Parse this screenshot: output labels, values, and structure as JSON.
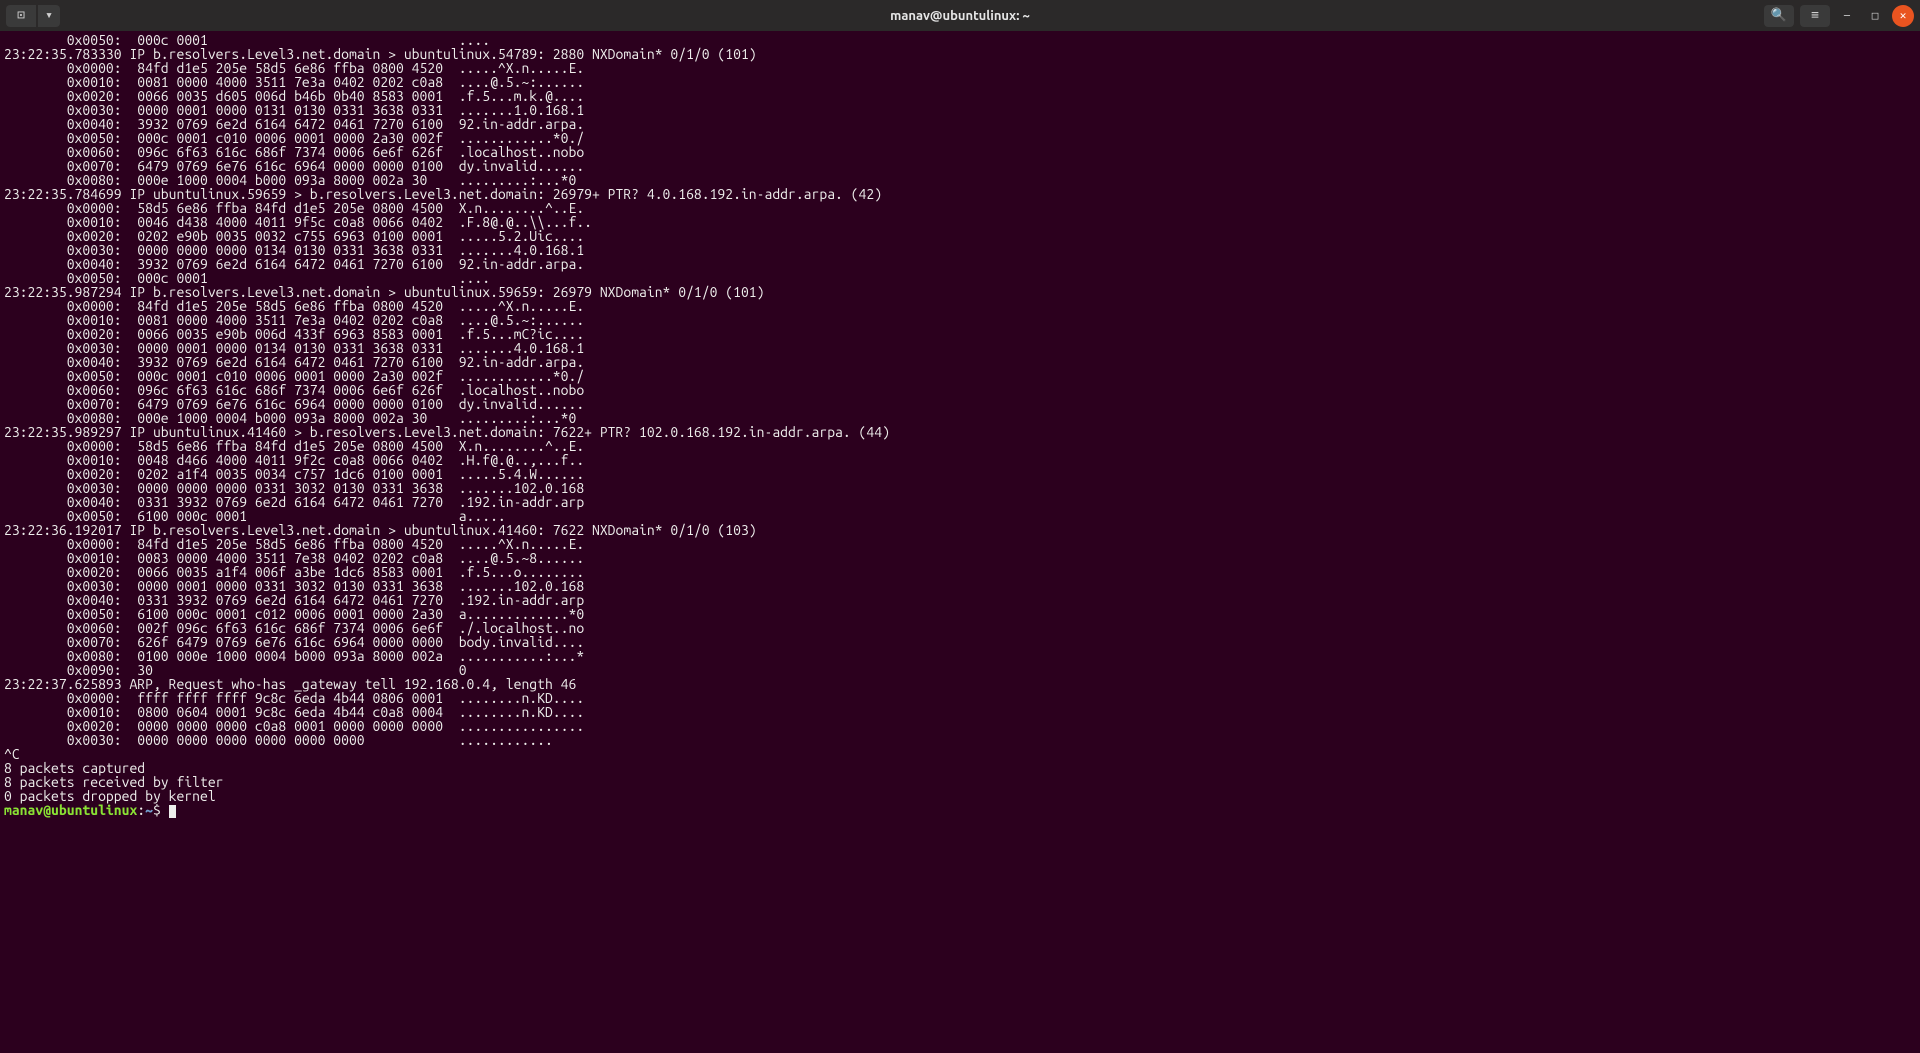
{
  "window": {
    "title": "manav@ubuntulinux: ~"
  },
  "prompt": {
    "user": "manav",
    "host": "ubuntulinux",
    "path": "~",
    "sep1": "@",
    "sep2": ":",
    "sigil": "$ "
  },
  "icons": {
    "new_tab": "⊡",
    "dropdown": "▾",
    "search": "🔍",
    "menu": "≡",
    "minimize": "—",
    "maximize": "□",
    "close": "✕"
  },
  "lines": [
    "        0x0050:  000c 0001                                ....",
    "23:22:35.783330 IP b.resolvers.Level3.net.domain > ubuntulinux.54789: 2880 NXDomain* 0/1/0 (101)",
    "        0x0000:  84fd d1e5 205e 58d5 6e86 ffba 0800 4520  .....^X.n.....E.",
    "        0x0010:  0081 0000 4000 3511 7e3a 0402 0202 c0a8  ....@.5.~:......",
    "        0x0020:  0066 0035 d605 006d b46b 0b40 8583 0001  .f.5...m.k.@....",
    "        0x0030:  0000 0001 0000 0131 0130 0331 3638 0331  .......1.0.168.1",
    "        0x0040:  3932 0769 6e2d 6164 6472 0461 7270 6100  92.in-addr.arpa.",
    "        0x0050:  000c 0001 c010 0006 0001 0000 2a30 002f  ............*0./",
    "        0x0060:  096c 6f63 616c 686f 7374 0006 6e6f 626f  .localhost..nobo",
    "        0x0070:  6479 0769 6e76 616c 6964 0000 0000 0100  dy.invalid......",
    "        0x0080:  000e 1000 0004 b000 093a 8000 002a 30    .........:...*0",
    "23:22:35.784699 IP ubuntulinux.59659 > b.resolvers.Level3.net.domain: 26979+ PTR? 4.0.168.192.in-addr.arpa. (42)",
    "        0x0000:  58d5 6e86 ffba 84fd d1e5 205e 0800 4500  X.n........^..E.",
    "        0x0010:  0046 d438 4000 4011 9f5c c0a8 0066 0402  .F.8@.@..\\\\...f..",
    "        0x0020:  0202 e90b 0035 0032 c755 6963 0100 0001  .....5.2.Uic....",
    "        0x0030:  0000 0000 0000 0134 0130 0331 3638 0331  .......4.0.168.1",
    "        0x0040:  3932 0769 6e2d 6164 6472 0461 7270 6100  92.in-addr.arpa.",
    "        0x0050:  000c 0001                                ....",
    "23:22:35.987294 IP b.resolvers.Level3.net.domain > ubuntulinux.59659: 26979 NXDomain* 0/1/0 (101)",
    "        0x0000:  84fd d1e5 205e 58d5 6e86 ffba 0800 4520  .....^X.n.....E.",
    "        0x0010:  0081 0000 4000 3511 7e3a 0402 0202 c0a8  ....@.5.~:......",
    "        0x0020:  0066 0035 e90b 006d 433f 6963 8583 0001  .f.5...mC?ic....",
    "        0x0030:  0000 0001 0000 0134 0130 0331 3638 0331  .......4.0.168.1",
    "        0x0040:  3932 0769 6e2d 6164 6472 0461 7270 6100  92.in-addr.arpa.",
    "        0x0050:  000c 0001 c010 0006 0001 0000 2a30 002f  ............*0./",
    "        0x0060:  096c 6f63 616c 686f 7374 0006 6e6f 626f  .localhost..nobo",
    "        0x0070:  6479 0769 6e76 616c 6964 0000 0000 0100  dy.invalid......",
    "        0x0080:  000e 1000 0004 b000 093a 8000 002a 30    .........:...*0",
    "23:22:35.989297 IP ubuntulinux.41460 > b.resolvers.Level3.net.domain: 7622+ PTR? 102.0.168.192.in-addr.arpa. (44)",
    "        0x0000:  58d5 6e86 ffba 84fd d1e5 205e 0800 4500  X.n........^..E.",
    "        0x0010:  0048 d466 4000 4011 9f2c c0a8 0066 0402  .H.f@.@..,...f..",
    "        0x0020:  0202 a1f4 0035 0034 c757 1dc6 0100 0001  .....5.4.W......",
    "        0x0030:  0000 0000 0000 0331 3032 0130 0331 3638  .......102.0.168",
    "        0x0040:  0331 3932 0769 6e2d 6164 6472 0461 7270  .192.in-addr.arp",
    "        0x0050:  6100 000c 0001                           a.....",
    "23:22:36.192017 IP b.resolvers.Level3.net.domain > ubuntulinux.41460: 7622 NXDomain* 0/1/0 (103)",
    "        0x0000:  84fd d1e5 205e 58d5 6e86 ffba 0800 4520  .....^X.n.....E.",
    "        0x0010:  0083 0000 4000 3511 7e38 0402 0202 c0a8  ....@.5.~8......",
    "        0x0020:  0066 0035 a1f4 006f a3be 1dc6 8583 0001  .f.5...o........",
    "        0x0030:  0000 0001 0000 0331 3032 0130 0331 3638  .......102.0.168",
    "        0x0040:  0331 3932 0769 6e2d 6164 6472 0461 7270  .192.in-addr.arp",
    "        0x0050:  6100 000c 0001 c012 0006 0001 0000 2a30  a.............*0",
    "        0x0060:  002f 096c 6f63 616c 686f 7374 0006 6e6f  ./.localhost..no",
    "        0x0070:  626f 6479 0769 6e76 616c 6964 0000 0000  body.invalid....",
    "        0x0080:  0100 000e 1000 0004 b000 093a 8000 002a  ...........:...*",
    "        0x0090:  30                                       0",
    "23:22:37.625893 ARP, Request who-has _gateway tell 192.168.0.4, length 46",
    "        0x0000:  ffff ffff ffff 9c8c 6eda 4b44 0806 0001  ........n.KD....",
    "        0x0010:  0800 0604 0001 9c8c 6eda 4b44 c0a8 0004  ........n.KD....",
    "        0x0020:  0000 0000 0000 c0a8 0001 0000 0000 0000  ................",
    "        0x0030:  0000 0000 0000 0000 0000 0000            ............",
    "^C",
    "8 packets captured",
    "8 packets received by filter",
    "0 packets dropped by kernel"
  ]
}
